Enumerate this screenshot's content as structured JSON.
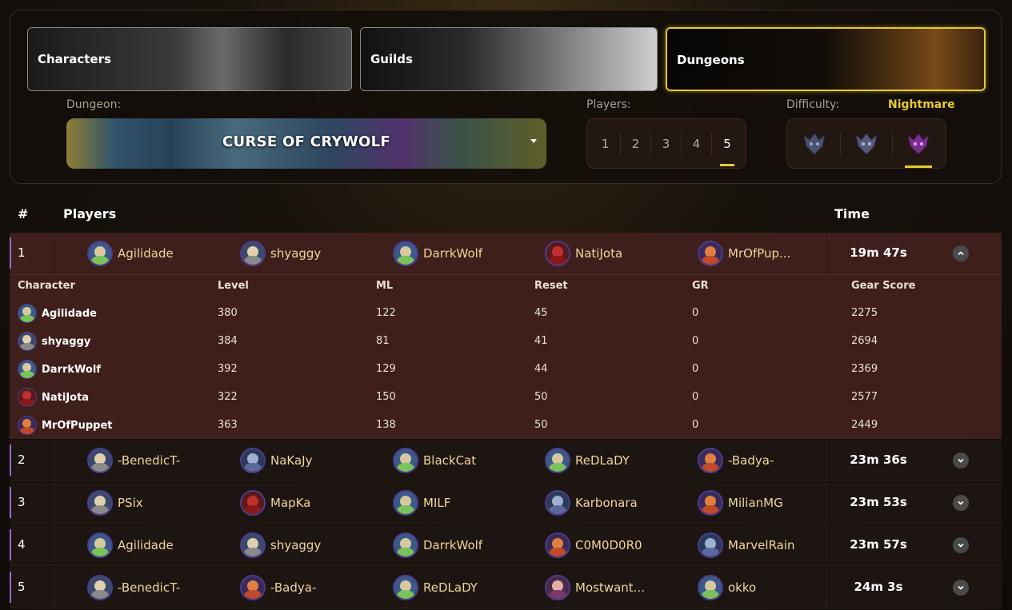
{
  "tabs": [
    {
      "label": "Characters"
    },
    {
      "label": "Guilds"
    },
    {
      "label": "Dungeons"
    }
  ],
  "filters": {
    "dungeon_label": "Dungeon:",
    "dungeon_value": "CURSE OF CRYWOLF",
    "players_label": "Players:",
    "players_options": [
      "1",
      "2",
      "3",
      "4",
      "5"
    ],
    "players_selected": "5",
    "difficulty_label": "Difficulty:",
    "difficulty_value": "Nightmare",
    "difficulty_icons": [
      "demon-normal-icon",
      "demon-hard-icon",
      "demon-nightmare-icon"
    ]
  },
  "table": {
    "headers": {
      "rank": "#",
      "players": "Players",
      "time": "Time"
    },
    "rows": [
      {
        "rank": "1",
        "time": "19m 47s",
        "expanded": true,
        "players": [
          "Agilidade",
          "shyaggy",
          "DarrkWolf",
          "NatiJota",
          "MrOfPup..."
        ]
      },
      {
        "rank": "2",
        "time": "23m 36s",
        "expanded": false,
        "players": [
          "-BenedicT-",
          "NaKaJy",
          "BlackCat",
          "ReDLaDY",
          "-Badya-"
        ]
      },
      {
        "rank": "3",
        "time": "23m 53s",
        "expanded": false,
        "players": [
          "PSix",
          "MapKa",
          "MILF",
          "Karbonara",
          "MilianMG"
        ]
      },
      {
        "rank": "4",
        "time": "23m 57s",
        "expanded": false,
        "players": [
          "Agilidade",
          "shyaggy",
          "DarrkWolf",
          "C0M0D0R0",
          "MarvelRain"
        ]
      },
      {
        "rank": "5",
        "time": "24m 3s",
        "expanded": false,
        "players": [
          "-BenedicT-",
          "-Badya-",
          "ReDLaDY",
          "Mostwant...",
          "okko"
        ]
      }
    ]
  },
  "detail": {
    "headers": {
      "character": "Character",
      "level": "Level",
      "ml": "ML",
      "reset": "Reset",
      "gr": "GR",
      "gear_score": "Gear Score"
    },
    "rows": [
      {
        "character": "Agilidade",
        "level": "380",
        "ml": "122",
        "reset": "45",
        "gr": "0",
        "gear_score": "2275"
      },
      {
        "character": "shyaggy",
        "level": "384",
        "ml": "81",
        "reset": "41",
        "gr": "0",
        "gear_score": "2694"
      },
      {
        "character": "DarrkWolf",
        "level": "392",
        "ml": "129",
        "reset": "44",
        "gr": "0",
        "gear_score": "2369"
      },
      {
        "character": "NatiJota",
        "level": "322",
        "ml": "150",
        "reset": "50",
        "gr": "0",
        "gear_score": "2577"
      },
      {
        "character": "MrOfPuppet",
        "level": "363",
        "ml": "138",
        "reset": "50",
        "gr": "0",
        "gear_score": "2449"
      }
    ]
  },
  "colors": {
    "accent": "#e7c930",
    "player_name": "#f0d59a",
    "expanded_row": "#3e1f1c",
    "row_stripe": "#9b6ac8"
  }
}
